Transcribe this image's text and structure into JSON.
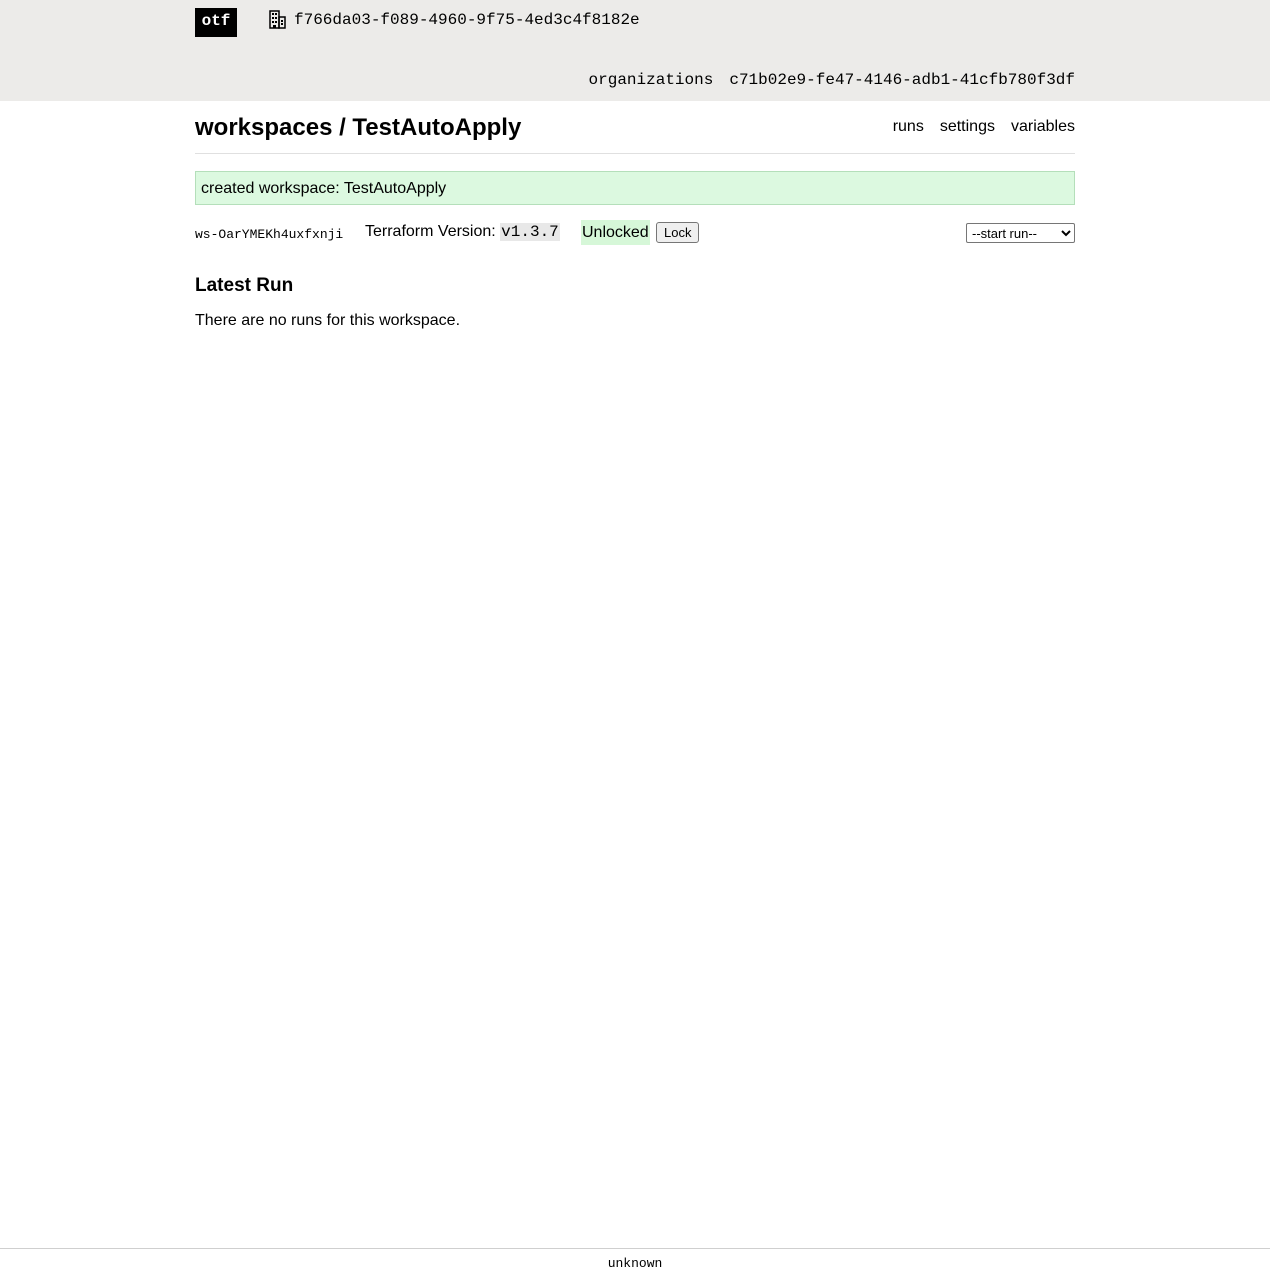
{
  "header": {
    "logo_text": "otf",
    "current_org_id": "f766da03-f089-4960-9f75-4ed3c4f8182e",
    "nav": {
      "organizations_label": "organizations",
      "org_link": "c71b02e9-fe47-4146-adb1-41cfb780f3df"
    },
    "bar_color": "#ecebe9"
  },
  "page": {
    "breadcrumb_title": "workspaces / TestAutoApply",
    "subnav": {
      "runs": "runs",
      "settings": "settings",
      "variables": "variables"
    }
  },
  "flash": {
    "message": "created workspace: TestAutoApply",
    "color": "#dcf9e0"
  },
  "workspace": {
    "id": "ws-OarYMEKh4uxfxnji",
    "terraform_version_label": "Terraform Version:",
    "terraform_version": "v1.3.7",
    "lock_status": "Unlocked",
    "lock_button": "Lock",
    "start_run_selected": "--start run--"
  },
  "latest_run": {
    "heading": "Latest Run",
    "empty_message": "There are no runs for this workspace."
  },
  "footer": {
    "version": "unknown"
  }
}
